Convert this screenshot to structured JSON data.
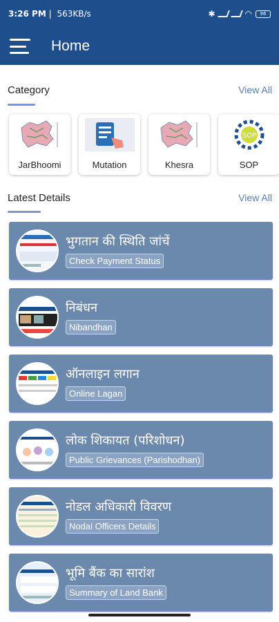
{
  "status": {
    "time": "3:26 PM",
    "rate": "563KB/s",
    "battery": "96"
  },
  "appbar": {
    "title": "Home",
    "menu_icon": "hamburger-menu-icon"
  },
  "category": {
    "heading": "Category",
    "view_all": "View All",
    "items": [
      {
        "label": "JarBhoomi",
        "icon": "bihar-map-icon"
      },
      {
        "label": "Mutation",
        "icon": "mutation-document-icon"
      },
      {
        "label": "Khesra",
        "icon": "bihar-map-icon"
      },
      {
        "label": "SOP",
        "icon": "sop-gear-icon"
      }
    ]
  },
  "latest": {
    "heading": "Latest Details",
    "view_all": "View All",
    "items": [
      {
        "hindi": "भुगतान की स्थिति जांचें",
        "english": "Check Payment Status"
      },
      {
        "hindi": "निबंधन",
        "english": "Nibandhan"
      },
      {
        "hindi": "ऑनलाइन लगान",
        "english": "Online Lagan"
      },
      {
        "hindi": "लोक शिकायत (परिशोधन)",
        "english": "Public Grievances (Parishodhan)"
      },
      {
        "hindi": "नोडल अधिकारी विवरण",
        "english": "Nodal Officers Details"
      },
      {
        "hindi": "भूमि बैंक का सारांश",
        "english": "Summary of Land Bank"
      }
    ]
  },
  "colors": {
    "primary": "#1f4e8c",
    "card": "#6b88ad",
    "link": "#5a7bb0"
  }
}
